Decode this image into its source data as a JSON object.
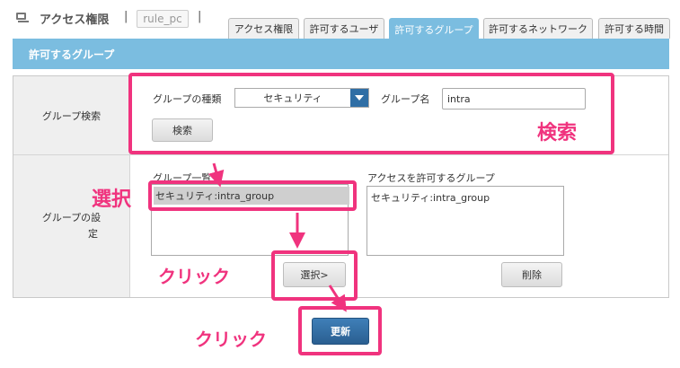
{
  "header": {
    "icon": "monitor-icon",
    "title": "アクセス権限",
    "separator": "|",
    "rule_name": "rule_pc",
    "separator2": "|"
  },
  "tabs": [
    {
      "label": "アクセス権限",
      "active": false
    },
    {
      "label": "許可するユーザ",
      "active": false
    },
    {
      "label": "許可するグループ",
      "active": true
    },
    {
      "label": "許可するネットワーク",
      "active": false
    },
    {
      "label": "許可する時間",
      "active": false
    }
  ],
  "section": {
    "title": "許可するグループ"
  },
  "search": {
    "row_label": "グループ検索",
    "type_label": "グループの種類",
    "type_value": "セキュリティ",
    "name_label": "グループ名",
    "name_value": "intra",
    "search_button": "検索"
  },
  "settings": {
    "row_label_line1": "グループの設",
    "row_label_line2": "定",
    "list_label": "グループ一覧",
    "list_items": [
      {
        "text": "セキュリティ:intra_group",
        "selected": true
      }
    ],
    "allowed_label": "アクセスを許可するグループ",
    "allowed_items": [
      {
        "text": "セキュリティ:intra_group"
      }
    ],
    "select_button": "選択>",
    "delete_button": "削除"
  },
  "update_button": "更新",
  "annotations": {
    "search": "検索",
    "select": "選択",
    "click1": "クリック",
    "click2": "クリック",
    "color": "#f0337e"
  }
}
